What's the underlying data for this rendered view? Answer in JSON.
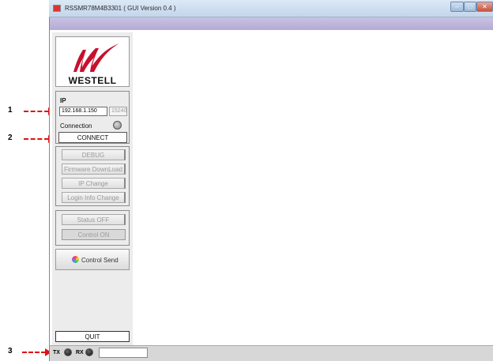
{
  "window": {
    "title": "RSSMR78M4B3301 ( GUI Version 0.4 )",
    "min_glyph": "–",
    "max_glyph": "□",
    "close_glyph": "✕"
  },
  "logo": {
    "brand": "WESTELL",
    "accent_color": "#c8102e"
  },
  "connection": {
    "ip_label": "IP",
    "ip_value": "192.168.1.150",
    "port_value": "15240",
    "connection_label": "Connection",
    "connect_label": "CONNECT"
  },
  "actions": {
    "debug": "DEBUG",
    "firmware": "Firmware DownLoad",
    "ip_change": "IP Change",
    "login_change": "Login Info Change"
  },
  "status": {
    "status_off": "Status OFF",
    "control_on": "Control ON"
  },
  "control_send_label": "Control Send",
  "quit_label": "QUIT",
  "statusbar": {
    "tx_label": "TX",
    "rx_label": "RX"
  },
  "annotations": {
    "one": "1",
    "two": "2",
    "three": "3"
  }
}
